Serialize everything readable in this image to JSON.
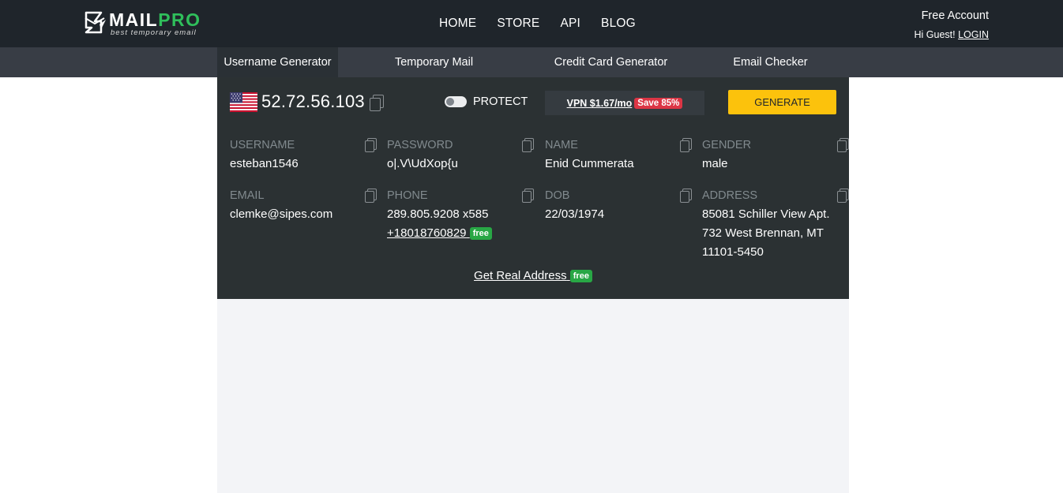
{
  "brand": {
    "name_part1": "MAIL",
    "name_part2": "PRO",
    "tagline": "best temporary email",
    "accent": "#2fbf5b"
  },
  "topnav": {
    "items": [
      "HOME",
      "STORE",
      "API",
      "BLOG"
    ]
  },
  "account": {
    "free_account": "Free Account",
    "greeting": "Hi Guest!",
    "login": "LOGIN"
  },
  "tabs": [
    {
      "label": "Username Generator",
      "active": true
    },
    {
      "label": "Temporary Mail",
      "active": false
    },
    {
      "label": "Credit Card Generator",
      "active": false
    },
    {
      "label": "Email Checker",
      "active": false
    }
  ],
  "ip_bar": {
    "flag": "us-flag-icon",
    "ip": "52.72.56.103",
    "protect_label": "PROTECT",
    "protect_on": false,
    "vpn_text": "VPN $1.67/mo",
    "vpn_badge": "Save 85%",
    "generate": "GENERATE"
  },
  "fields": {
    "username": {
      "label": "USERNAME",
      "value": "esteban1546"
    },
    "password": {
      "label": "PASSWORD",
      "value": "o|.V\\UdXop{u"
    },
    "name": {
      "label": "NAME",
      "value": "Enid Cummerata"
    },
    "gender": {
      "label": "GENDER",
      "value": "male"
    },
    "email": {
      "label": "EMAIL",
      "value": "clemke@sipes.com"
    },
    "phone": {
      "label": "PHONE",
      "value": "289.805.9208 x585",
      "alt_number": "+18018760829",
      "alt_badge": "free"
    },
    "dob": {
      "label": "DOB",
      "value": "22/03/1974"
    },
    "address": {
      "label": "ADDRESS",
      "line1": "85081 Schiller View Apt.",
      "line2": "732 West Brennan, MT",
      "line3": "11101-5450"
    }
  },
  "real_address": {
    "label": "Get Real Address",
    "badge": "free"
  },
  "colors": {
    "topbar": "#1f252b",
    "subbar": "#383d45",
    "panel": "#2b3133",
    "generate": "#fcc20c",
    "save_badge": "#dc3545",
    "free_badge": "#28a745"
  }
}
